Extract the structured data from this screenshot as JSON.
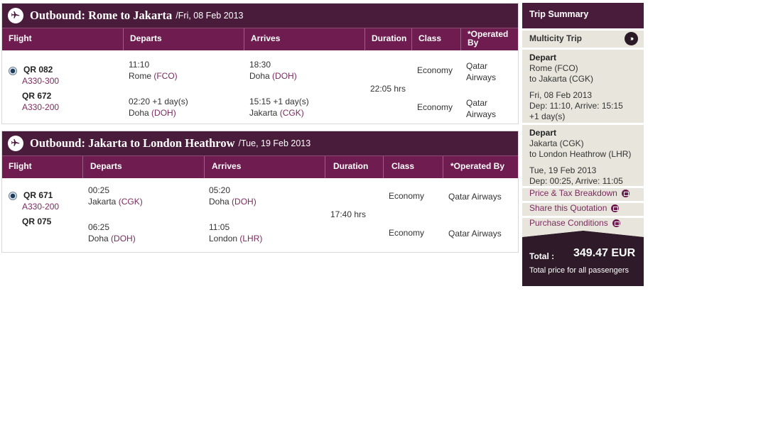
{
  "sections": [
    {
      "title": "Outbound: Rome to Jakarta",
      "date": "/Fri, 08 Feb 2013",
      "columns": [
        "Flight",
        "Departs",
        "Arrives",
        "Duration",
        "Class",
        "*Operated By"
      ],
      "duration": "22:05 hrs",
      "legs": [
        {
          "flight": "QR 082",
          "aircraft": "A330-300",
          "dep_time": "11:10",
          "dep_city": "Rome",
          "dep_code": "(FCO)",
          "arr_time": "18:30",
          "arr_city": "Doha",
          "arr_code": "(DOH)",
          "class": "Economy",
          "operated_by": "Qatar Airways"
        },
        {
          "flight": "QR 672",
          "aircraft": "A330-200",
          "dep_time": "02:20 +1 day(s)",
          "dep_city": "Doha",
          "dep_code": "(DOH)",
          "arr_time": "15:15 +1 day(s)",
          "arr_city": "Jakarta",
          "arr_code": "(CGK)",
          "class": "Economy",
          "operated_by": "Qatar Airways"
        }
      ]
    },
    {
      "title": "Outbound: Jakarta to London Heathrow",
      "date": "/Tue, 19 Feb 2013",
      "columns": [
        "Flight",
        "Departs",
        "Arrives",
        "Duration",
        "Class",
        "*Operated By"
      ],
      "duration": "17:40 hrs",
      "legs": [
        {
          "flight": "QR 671",
          "aircraft": "A330-200",
          "dep_time": "00:25",
          "dep_city": "Jakarta",
          "dep_code": "(CGK)",
          "arr_time": "05:20",
          "arr_city": "Doha",
          "arr_code": "(DOH)",
          "class": "Economy",
          "operated_by": "Qatar Airways"
        },
        {
          "flight": "QR 075",
          "aircraft": "",
          "dep_time": "06:25",
          "dep_city": "Doha",
          "dep_code": "(DOH)",
          "arr_time": "11:05",
          "arr_city": "London",
          "arr_code": "(LHR)",
          "class": "Economy",
          "operated_by": "Qatar Airways"
        }
      ]
    }
  ],
  "summary": {
    "title": "Trip Summary",
    "trip_type": "Multicity Trip",
    "go_icon": "arrows-right-icon",
    "trips": [
      {
        "label": "Depart",
        "from": "Rome (FCO)",
        "to": "to Jakarta (CGK)",
        "date": "Fri, 08 Feb 2013",
        "times1": "Dep: 11:10, Arrive: 15:15",
        "times2": "+1 day(s)"
      },
      {
        "label": "Depart",
        "from": "Jakarta (CGK)",
        "to": "to London Heathrow (LHR)",
        "date": "Tue, 19 Feb 2013",
        "times1": "Dep: 00:25, Arrive: 11:05",
        "times2": ""
      }
    ],
    "links": [
      "Price & Tax Breakdown",
      "Share this Quotation",
      "Purchase Conditions"
    ],
    "total_label": "Total :",
    "total_value": "349.47 EUR",
    "total_note": "Total price for all passengers"
  },
  "colors": {
    "header": "#4a1c3b",
    "columns": "#6f1d50",
    "link": "#7a2b5e"
  }
}
